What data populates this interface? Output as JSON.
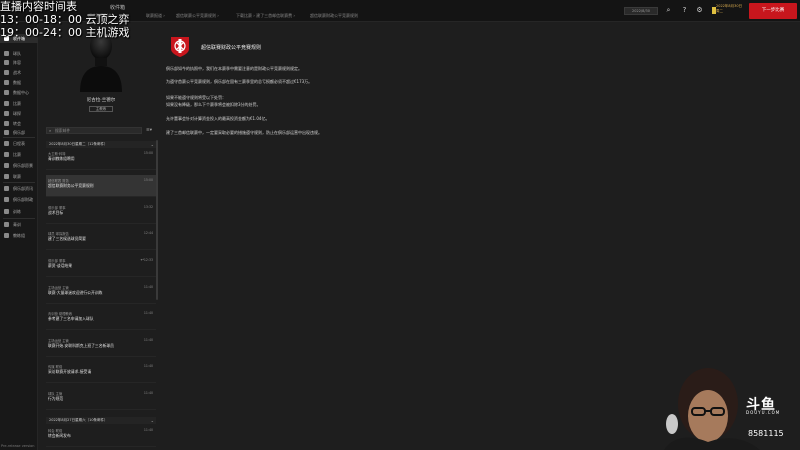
{
  "overlay": {
    "line1": "直播内容时间表",
    "line2": "13：00-18：00 云顶之弈",
    "line3": "19：00-24：00 主机游戏"
  },
  "topbar": {
    "mailbox_title": "收件箱",
    "crumbs": [
      "超信联赛财产 ›",
      "联赛报道 ›",
      "超信联赛公平竞赛规则 ›",
      "下载比赛 › 建了三首邮信联赛费 ›",
      "超信联赛财政公平竞赛规则"
    ],
    "date_box": "2022/8/30",
    "user_date": "2022年8月30日 周二",
    "continue_label": "下一步比赛"
  },
  "sidebar": {
    "items": [
      {
        "label": "收件箱",
        "active": true
      },
      {
        "label": "球队"
      },
      {
        "label": "阵容"
      },
      {
        "label": "战术"
      },
      {
        "label": "数据"
      },
      {
        "label": "数据中心"
      },
      {
        "label": "比赛"
      },
      {
        "label": "球探"
      },
      {
        "label": "转会"
      },
      {
        "label": "俱乐部"
      },
      {
        "label": "日程表"
      },
      {
        "label": "比赛"
      },
      {
        "label": "俱乐部愿景"
      },
      {
        "label": "联赛"
      },
      {
        "label": "俱乐部资讯"
      },
      {
        "label": "俱乐部财政"
      },
      {
        "label": "训练"
      },
      {
        "label": "青训"
      },
      {
        "label": "教练组"
      }
    ],
    "version": "Pre-release version"
  },
  "profile": {
    "name": "尼古拉·兰德尔",
    "role": "主教练"
  },
  "inbox": {
    "search_placeholder": "搜索邮件",
    "filter_icon": "filter-icon",
    "group1": "2022年8月30日星期二（12条邮件）",
    "group2": "2022年8月27日星期六（10条邮件）",
    "messages": [
      {
        "sender": "大卫斯·科特",
        "subject": "青训教练组聘用",
        "time": "15:00"
      },
      {
        "sender": "超信联赛 财务",
        "subject": "超信联赛财务公平竞赛规则",
        "time": "15:00"
      },
      {
        "sender": "俱乐部 董事",
        "subject": "战术目标",
        "time": "13:32"
      },
      {
        "sender": "球员 球探报告",
        "subject": "建了三名候选球员简要",
        "time": "12:44"
      },
      {
        "sender": "俱乐部 董事",
        "subject": "薪资·谈话结果",
        "time": "12:33"
      },
      {
        "sender": "主场运营 主管",
        "subject": "联赛·大量球迷欢迎进行公开训练",
        "time": "11:40"
      },
      {
        "sender": "青训营 助理教练",
        "subject": "参考建了三名申请加入球队",
        "time": "11:40"
      },
      {
        "sender": "主场运营 主管",
        "subject": "联赛开始-安联科斯克上班了三名新球员",
        "time": "11:40"
      },
      {
        "sender": "传媒 联络",
        "subject": "采访联赛开放请求-接受请",
        "time": "11:40"
      },
      {
        "sender": "球队 主管",
        "subject": "行为规范",
        "time": "11:40"
      },
      {
        "sender": "转会 联络",
        "subject": "转会新闻发布",
        "time": "11:40"
      }
    ]
  },
  "main": {
    "title": "超信联赛财政公平竞赛规则",
    "paragraphs": [
      "俱乐部如今的执照中，我们在本赛季中需要注意的是财政公平竞赛规则规定。",
      "为遵守首赛公平竞赛规则，俱乐部在固有三赛季里的总亏损额必须不超过€173万。",
      "如果不能遵守规则将受以下处罚：",
      "如果没有降级，那么下个赛季将会被扣除3分的处罚。",
      "允许董事会针对计算资金投入的最高投资金额为€1.04亿。",
      "建了三首邮信联赛中，一定要采取必要的措施遵守规则，防止在俱乐部运营中出现违规。"
    ]
  },
  "stream": {
    "platform": "斗鱼",
    "platform_sub": "DOUYU.COM",
    "room_id": "8581115"
  },
  "colors": {
    "accent": "#c8161d",
    "background": "#1e1e1e",
    "sidebar": "#181818"
  }
}
